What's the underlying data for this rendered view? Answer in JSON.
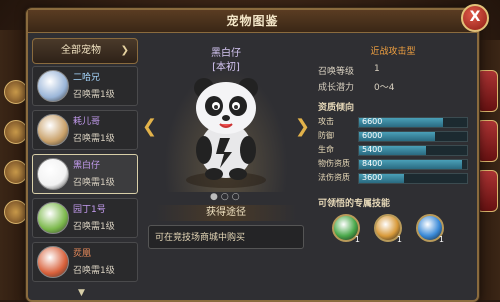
{
  "window": {
    "title": "宠物图鉴",
    "close": "X"
  },
  "filter": {
    "label": "全部宠物"
  },
  "pets": [
    {
      "name": "二哈兄",
      "req": "召唤需1级",
      "name_color": "#a8d8ff",
      "avatar_color": "#9ab5d8"
    },
    {
      "name": "耗儿哥",
      "req": "召唤需1级",
      "name_color": "#c49cf0",
      "avatar_color": "#c9a16a"
    },
    {
      "name": "黑白仔",
      "req": "召唤需1级",
      "name_color": "#c49cf0",
      "avatar_color": "#f2f2f2"
    },
    {
      "name": "园丁1号",
      "req": "召唤需1级",
      "name_color": "#c49cf0",
      "avatar_color": "#7bb84a"
    },
    {
      "name": "烎凰",
      "req": "召唤需1级",
      "name_color": "#e88a5a",
      "avatar_color": "#d8603a"
    }
  ],
  "detail": {
    "name": "黑白仔",
    "quality": "[本初]",
    "obtain_title": "获得途径",
    "obtain_text": "可在竞技场商城中购买"
  },
  "info": {
    "type": "近战攻击型",
    "summon_label": "召唤等级",
    "summon_value": "1",
    "growth_label": "成长潜力",
    "growth_value": "0～4",
    "aptitude_title": "资质倾向",
    "skills_title": "可领悟的专属技能"
  },
  "stats": [
    {
      "label": "攻击",
      "value": "6600",
      "level": 0.78
    },
    {
      "label": "防御",
      "value": "6000",
      "level": 0.7
    },
    {
      "label": "生命",
      "value": "5400",
      "level": 0.62
    },
    {
      "label": "物伤资质",
      "value": "8400",
      "level": 0.95
    },
    {
      "label": "法伤资质",
      "value": "3600",
      "level": 0.42
    }
  ],
  "skills": [
    {
      "icon": "green-slash-skill-icon",
      "level": "1",
      "color": "#4aa84a"
    },
    {
      "icon": "orange-slash-skill-icon",
      "level": "1",
      "color": "#d89a3a"
    },
    {
      "icon": "blue-slash-skill-icon",
      "level": "1",
      "color": "#3a8ad8"
    }
  ]
}
